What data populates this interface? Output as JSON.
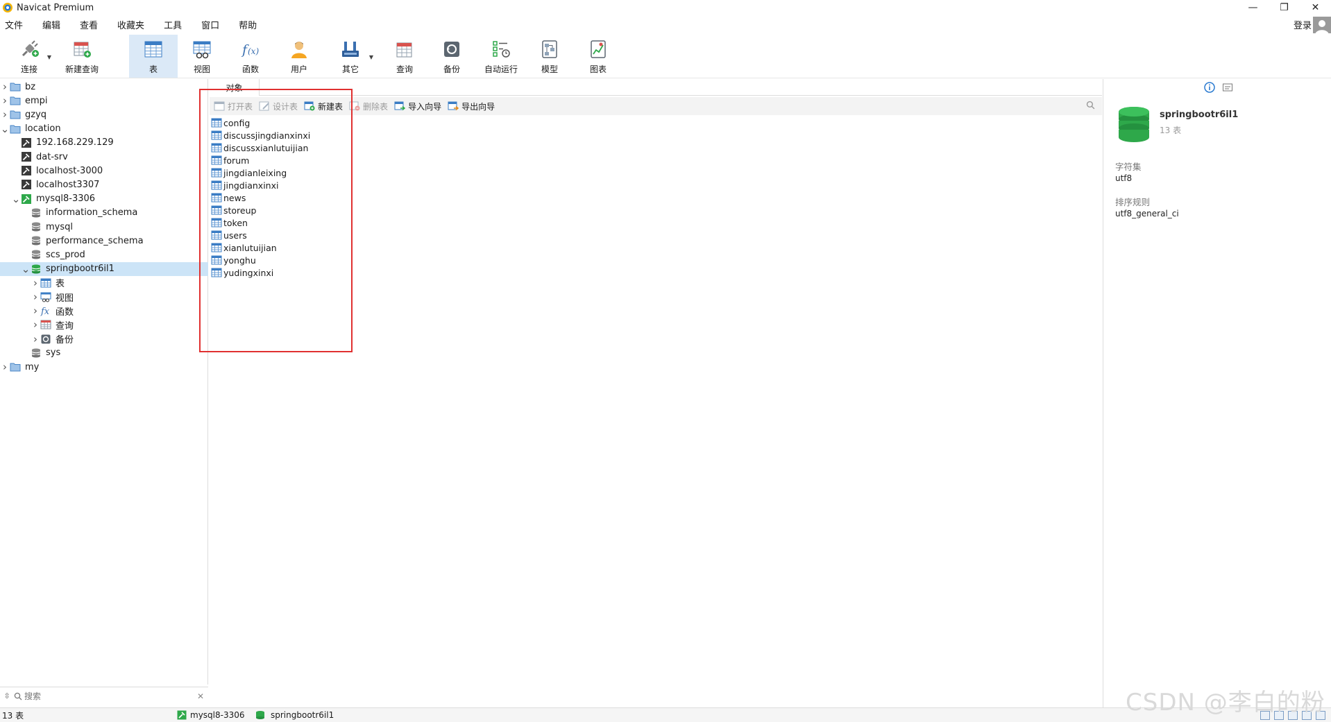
{
  "window": {
    "title": "Navicat Premium",
    "controls": [
      "—",
      "❐",
      "✕"
    ]
  },
  "menu": {
    "items": [
      "文件",
      "编辑",
      "查看",
      "收藏夹",
      "工具",
      "窗口",
      "帮助"
    ],
    "login_label": "登录"
  },
  "toolbar": {
    "buttons": [
      {
        "label": "连接",
        "icon": "connection-icon"
      },
      {
        "label": "新建查询",
        "icon": "new-query-icon"
      },
      {
        "label": "表",
        "icon": "table-icon",
        "active": true
      },
      {
        "label": "视图",
        "icon": "view-icon"
      },
      {
        "label": "函数",
        "icon": "function-icon"
      },
      {
        "label": "用户",
        "icon": "user-icon"
      },
      {
        "label": "其它",
        "icon": "tools-icon"
      },
      {
        "label": "查询",
        "icon": "query-icon"
      },
      {
        "label": "备份",
        "icon": "backup-icon"
      },
      {
        "label": "自动运行",
        "icon": "schedule-icon"
      },
      {
        "label": "模型",
        "icon": "model-icon"
      },
      {
        "label": "图表",
        "icon": "chart-icon"
      }
    ]
  },
  "tree": {
    "nodes": [
      {
        "label": "bz",
        "type": "group",
        "expanded": false
      },
      {
        "label": "empi",
        "type": "group",
        "expanded": false
      },
      {
        "label": "gzyq",
        "type": "group",
        "expanded": false
      },
      {
        "label": "location",
        "type": "group",
        "expanded": true
      },
      {
        "label": "192.168.229.129",
        "type": "connection"
      },
      {
        "label": "dat-srv",
        "type": "connection"
      },
      {
        "label": "localhost-3000",
        "type": "connection"
      },
      {
        "label": "localhost3307",
        "type": "connection"
      },
      {
        "label": "mysql8-3306",
        "type": "connection-open",
        "expanded": true
      },
      {
        "label": "information_schema",
        "type": "database"
      },
      {
        "label": "mysql",
        "type": "database"
      },
      {
        "label": "performance_schema",
        "type": "database"
      },
      {
        "label": "scs_prod",
        "type": "database"
      },
      {
        "label": "springbootr6il1",
        "type": "database-open",
        "expanded": true,
        "selected": true
      },
      {
        "label": "表",
        "type": "tables"
      },
      {
        "label": "视图",
        "type": "views"
      },
      {
        "label": "函数",
        "type": "functions"
      },
      {
        "label": "查询",
        "type": "queries"
      },
      {
        "label": "备份",
        "type": "backups"
      },
      {
        "label": "sys",
        "type": "database"
      },
      {
        "label": "my",
        "type": "group",
        "expanded": false
      }
    ],
    "search_placeholder": "搜索"
  },
  "center": {
    "tab_label": "对象",
    "object_bar": [
      {
        "label": "打开表",
        "enabled": false
      },
      {
        "label": "设计表",
        "enabled": false
      },
      {
        "label": "新建表",
        "enabled": true
      },
      {
        "label": "删除表",
        "enabled": false
      },
      {
        "label": "导入向导",
        "enabled": true
      },
      {
        "label": "导出向导",
        "enabled": true
      }
    ],
    "tables": [
      "config",
      "discussjingdianxinxi",
      "discussxianlutuijian",
      "forum",
      "jingdianleixing",
      "jingdianxinxi",
      "news",
      "storeup",
      "token",
      "users",
      "xianlutuijian",
      "yonghu",
      "yudingxinxi"
    ]
  },
  "info": {
    "db_name": "springbootr6il1",
    "table_count": "13 表",
    "charset_label": "字符集",
    "charset_value": "utf8",
    "collation_label": "排序规则",
    "collation_value": "utf8_general_ci"
  },
  "status": {
    "count": "13 表",
    "connection": "mysql8-3306",
    "database": "springbootr6il1"
  },
  "watermark": "CSDN @李白的粉",
  "colors": {
    "accent": "#dbe9f7",
    "selection": "#cce4f7",
    "highlight_box": "#e03030",
    "db_green": "#2ea84a"
  }
}
